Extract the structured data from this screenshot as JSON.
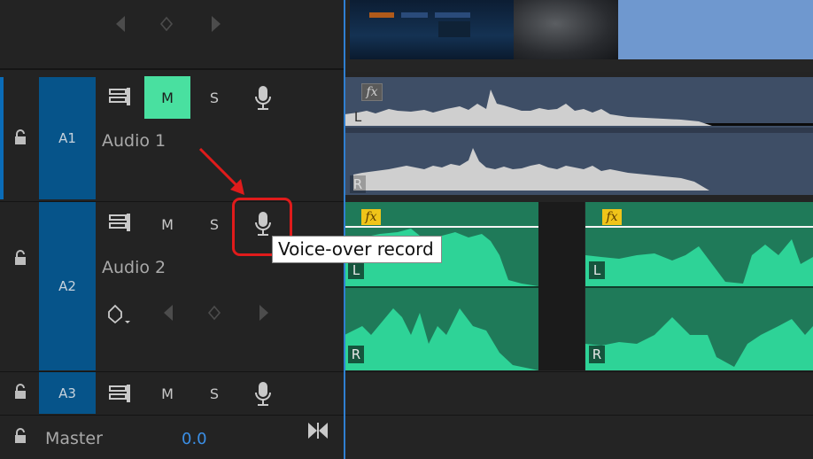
{
  "tracks": {
    "a1": {
      "id": "A1",
      "name": "Audio 1",
      "mute_label": "M",
      "solo_label": "S",
      "mute_active": true
    },
    "a2": {
      "id": "A2",
      "name": "Audio 2",
      "mute_label": "M",
      "solo_label": "S"
    },
    "a3": {
      "id": "A3",
      "mute_label": "M",
      "solo_label": "S"
    },
    "master": {
      "name": "Master",
      "volume": "0.0"
    }
  },
  "clip_labels": {
    "fx": "fx",
    "left": "L",
    "right": "R"
  },
  "tooltip": {
    "text": "Voice-over record"
  },
  "colors": {
    "track_label_bg": "#06548a",
    "mute_active": "#49e0a0",
    "clip_a1": "#3e4e66",
    "clip_a2": "#1f7a59",
    "wave_a2": "#2ed397",
    "fx_badge": "#f0c419",
    "playhead": "#2f7fd1",
    "highlight": "#e01b1b"
  },
  "icons": [
    "lock-icon",
    "track-output-icon",
    "microphone-icon",
    "keyframe-diamond-icon",
    "previous-keyframe-icon",
    "next-keyframe-icon",
    "keyframe-menu-icon",
    "bowtie-icon"
  ]
}
